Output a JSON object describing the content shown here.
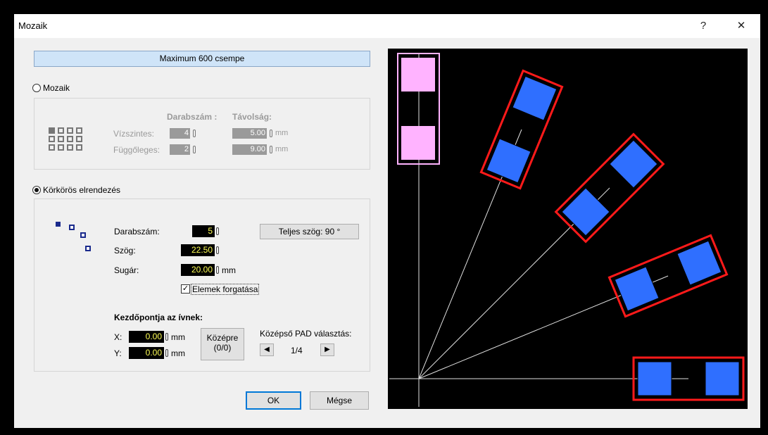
{
  "window": {
    "title": "Mozaik",
    "help_symbol": "?",
    "close_symbol": "✕"
  },
  "banner": "Maximum 600 csempe",
  "mozaik": {
    "radio_label": "Mozaik",
    "selected": false,
    "header_count": "Darabszám :",
    "header_distance": "Távolság:",
    "rows": [
      {
        "label": "Vízszintes:",
        "count": "4",
        "distance": "5.00",
        "unit": "mm"
      },
      {
        "label": "Függőleges:",
        "count": "2",
        "distance": "9.00",
        "unit": "mm"
      }
    ]
  },
  "circular": {
    "radio_label": "Körkörös elrendezés",
    "selected": true,
    "count_label": "Darabszám:",
    "count_value": "5",
    "angle_label": "Szög:",
    "angle_value": "22.50",
    "radius_label": "Sugár:",
    "radius_value": "20.00",
    "radius_unit": "mm",
    "total_angle_label": "Teljes szög:  90 °",
    "rotate_label": "Elemek forgatása",
    "rotate_checked": true,
    "start_title": "Kezdőpontja az ívnek:",
    "x_label": "X:",
    "x_value": "0.00",
    "y_label": "Y:",
    "y_value": "0.00",
    "unit": "mm",
    "center_button": [
      "Középre",
      "(0/0)"
    ],
    "pad_label": "Középső PAD választás:",
    "pad_value": "1/4",
    "prev_symbol": "◀",
    "next_symbol": "▶"
  },
  "buttons": {
    "ok": "OK",
    "cancel": "Mégse"
  },
  "colors": {
    "pad": "#2f6fff",
    "outline": "#ff1a1a",
    "selected_pad": "#ffb3ff",
    "selected_outline": "#ffb3ff",
    "preview_bg": "#000000",
    "axis": "#e0e0e0"
  }
}
